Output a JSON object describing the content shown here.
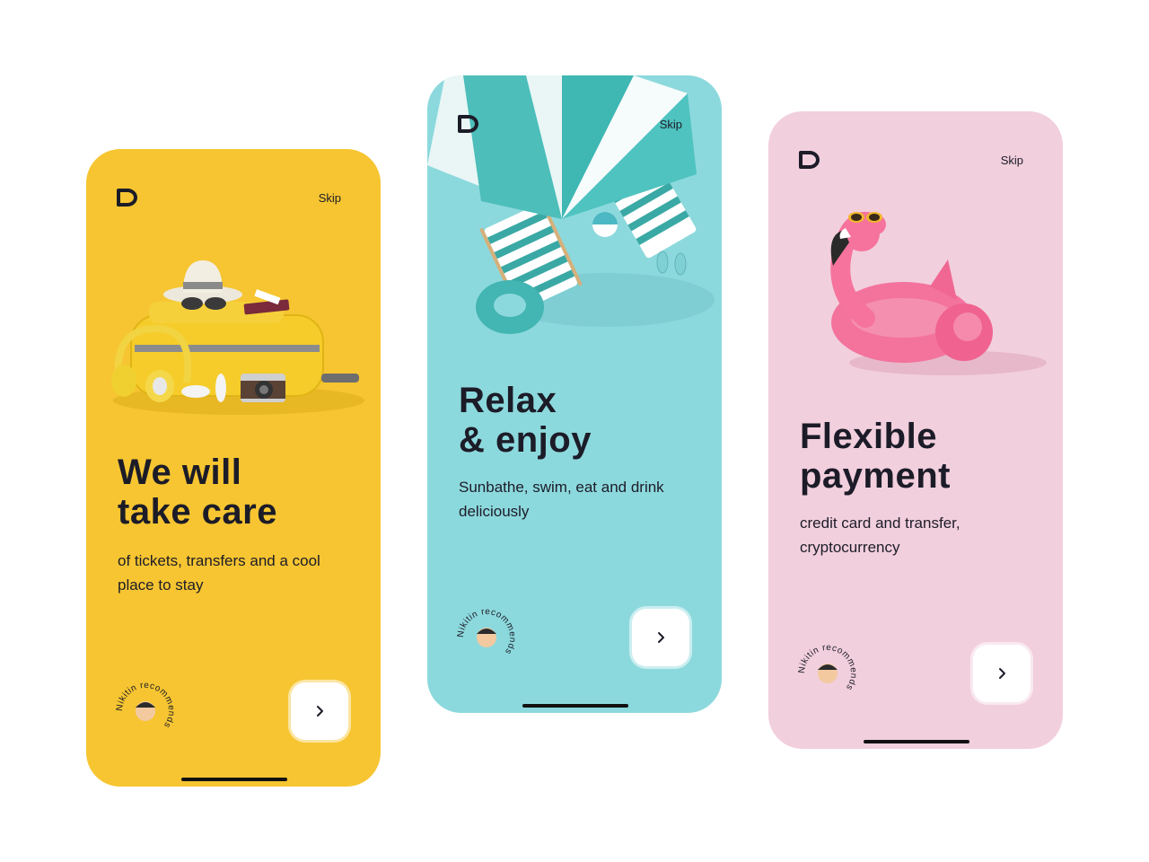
{
  "screens": [
    {
      "skip": "Skip",
      "title_line1": "We will",
      "title_line2": "take care",
      "subtitle": "of tickets, transfers and a cool place to stay",
      "badge_text": "Nikitin recommends",
      "background": "#f6c531",
      "hero": "suitcase-with-hat-headphones-camera"
    },
    {
      "skip": "Skip",
      "title_line1": "Relax",
      "title_line2": "& enjoy",
      "subtitle": "Sunbathe, swim, eat and drink deliciously",
      "badge_text": "Nikitin recommends",
      "background": "#8cd9dd",
      "hero": "beach-umbrella-with-deck-chairs"
    },
    {
      "skip": "Skip",
      "title_line1": "Flexible",
      "title_line2": "payment",
      "subtitle": "credit card and transfer, cryptocurrency",
      "badge_text": "Nikitin recommends",
      "background": "#f2cfdd",
      "hero": "inflatable-flamingo"
    }
  ],
  "colors": {
    "text": "#1c1c28",
    "button": "#ffffff"
  }
}
